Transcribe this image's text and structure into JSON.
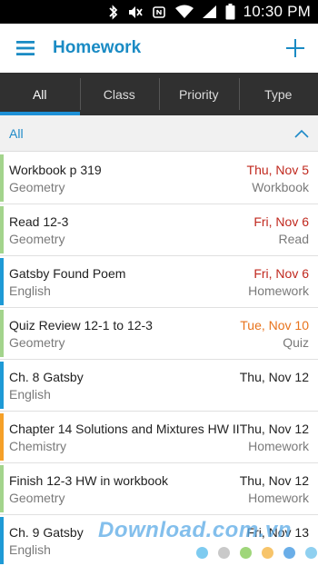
{
  "status_bar": {
    "time": "10:30 PM",
    "icons": [
      "bluetooth-icon",
      "mute-icon",
      "nfc-icon",
      "wifi-icon",
      "signal-icon",
      "battery-icon"
    ]
  },
  "app_bar": {
    "title": "Homework",
    "menu_icon": "hamburger-menu-icon",
    "add_icon": "plus-icon",
    "accent_color": "#1a8bc4"
  },
  "tabs": [
    {
      "label": "All",
      "active": true
    },
    {
      "label": "Class",
      "active": false
    },
    {
      "label": "Priority",
      "active": false
    },
    {
      "label": "Type",
      "active": false
    }
  ],
  "filter": {
    "label": "All",
    "icon": "chevron-up-icon"
  },
  "assignments": [
    {
      "title": "Workbook p 319",
      "subject": "Geometry",
      "date": "Thu, Nov 5",
      "type": "Workbook",
      "date_color": "#c0281e",
      "bar_color": "#a3d48c"
    },
    {
      "title": "Read 12-3",
      "subject": "Geometry",
      "date": "Fri, Nov 6",
      "type": "Read",
      "date_color": "#c0281e",
      "bar_color": "#a3d48c"
    },
    {
      "title": "Gatsby Found Poem",
      "subject": "English",
      "date": "Fri, Nov 6",
      "type": "Homework",
      "date_color": "#c0281e",
      "bar_color": "#1e9ad6"
    },
    {
      "title": "Quiz Review 12-1 to 12-3",
      "subject": "Geometry",
      "date": "Tue, Nov 10",
      "type": "Quiz",
      "date_color": "#e8731c",
      "bar_color": "#a3d48c"
    },
    {
      "title": "Ch. 8 Gatsby",
      "subject": "English",
      "date": "Thu, Nov 12",
      "type": "",
      "date_color": "#222222",
      "bar_color": "#1e9ad6"
    },
    {
      "title": "Chapter 14 Solutions and Mixtures HW II",
      "subject": "Chemistry",
      "date": "Thu, Nov 12",
      "type": "Homework",
      "date_color": "#222222",
      "bar_color": "#f5a028"
    },
    {
      "title": "Finish 12-3 HW in workbook",
      "subject": "Geometry",
      "date": "Thu, Nov 12",
      "type": "Homework",
      "date_color": "#222222",
      "bar_color": "#a3d48c"
    },
    {
      "title": "Ch. 9 Gatsby",
      "subject": "English",
      "date": "Fri, Nov 13",
      "type": "",
      "date_color": "#222222",
      "bar_color": "#1e9ad6"
    }
  ],
  "watermark": {
    "text": "Download.com.vn",
    "dot_colors": [
      "#7ecbf0",
      "#c9c9c9",
      "#9fd67a",
      "#f7c46a",
      "#6aaee8",
      "#8fd0f0"
    ]
  }
}
